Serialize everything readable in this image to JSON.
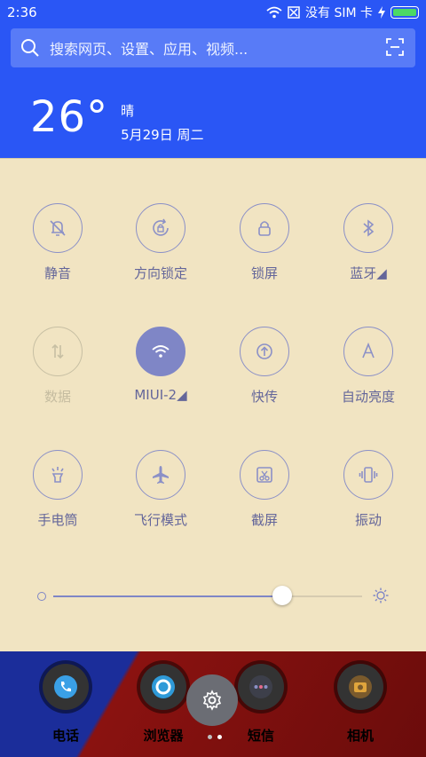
{
  "status": {
    "time": "2:36",
    "carrier": "没有 SIM 卡"
  },
  "search": {
    "placeholder": "搜索网页、设置、应用、视频..."
  },
  "weather": {
    "temp": "26°",
    "condition": "晴",
    "date": "5月29日 周二"
  },
  "toggles": [
    {
      "label": "静音",
      "icon": "bell-off-icon",
      "state": "off"
    },
    {
      "label": "方向锁定",
      "icon": "rotation-lock-icon",
      "state": "off"
    },
    {
      "label": "锁屏",
      "icon": "lock-icon",
      "state": "off"
    },
    {
      "label": "蓝牙◢",
      "icon": "bluetooth-icon",
      "state": "off"
    },
    {
      "label": "数据",
      "icon": "data-icon",
      "state": "disabled"
    },
    {
      "label": "MIUI-2◢",
      "icon": "wifi-icon",
      "state": "on"
    },
    {
      "label": "快传",
      "icon": "transfer-icon",
      "state": "off"
    },
    {
      "label": "自动亮度",
      "icon": "auto-brightness-icon",
      "state": "off"
    },
    {
      "label": "手电筒",
      "icon": "flashlight-icon",
      "state": "off"
    },
    {
      "label": "飞行模式",
      "icon": "airplane-icon",
      "state": "off"
    },
    {
      "label": "截屏",
      "icon": "screenshot-icon",
      "state": "off"
    },
    {
      "label": "振动",
      "icon": "vibrate-icon",
      "state": "off"
    }
  ],
  "brightness": {
    "level": 0.7
  },
  "dock": [
    {
      "label": "电话",
      "icon": "phone-icon"
    },
    {
      "label": "浏览器",
      "icon": "browser-icon"
    },
    {
      "label": "短信",
      "icon": "messages-icon"
    },
    {
      "label": "相机",
      "icon": "camera-icon"
    }
  ],
  "colors": {
    "accent": "#7f86c6",
    "panel": "#f1e4c2",
    "header": "#2a56f5"
  }
}
